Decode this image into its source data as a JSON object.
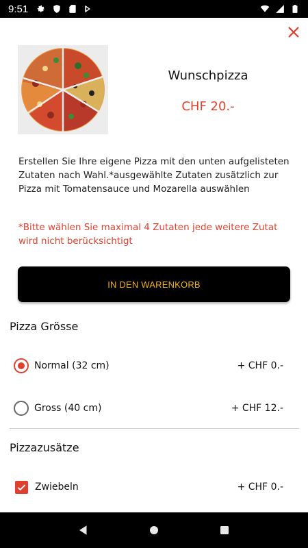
{
  "status_bar": {
    "time": "9:51",
    "left_icons": [
      "gear-icon",
      "shield-icon",
      "sd-card-icon",
      "play-store-icon"
    ],
    "right_icons": [
      "wifi-icon",
      "cell-signal-icon",
      "battery-icon"
    ]
  },
  "product": {
    "title": "Wunschpizza",
    "price": "CHF 20.-",
    "image_icon": "pizza-image",
    "description": "Erstellen Sie Ihre eigene Pizza mit den unten aufgelisteten Zutaten nach Wahl.*ausgewählte Zutaten zusätzlich zur Pizza mit Tomatensauce und Mozarella auswählen",
    "warning": "*Bitte wählen Sie maximal 4 Zutaten jede weitere Zutat wird nicht berücksichtigt",
    "cart_button_label": "IN DEN WARENKORB"
  },
  "size_section": {
    "title": "Pizza Grösse",
    "options": [
      {
        "label": "Normal (32 cm)",
        "price": "+ CHF 0.-",
        "selected": true
      },
      {
        "label": "Gross (40 cm)",
        "price": "+ CHF 12.-",
        "selected": false
      }
    ]
  },
  "extras_section": {
    "title": "Pizzazusätze",
    "options": [
      {
        "label": "Zwiebeln",
        "price": "+ CHF 0.-",
        "checked": true
      }
    ]
  },
  "nav_bar": {
    "icons": [
      "back-icon",
      "home-icon",
      "recents-icon"
    ]
  },
  "colors": {
    "accent": "#e0402e",
    "button_bg": "#000000",
    "button_text": "#f2b417"
  }
}
